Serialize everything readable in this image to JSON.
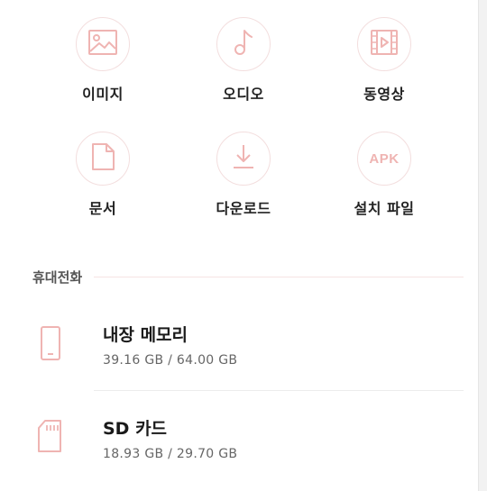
{
  "categories": [
    {
      "label": "이미지",
      "icon": "image-icon"
    },
    {
      "label": "오디오",
      "icon": "music-note-icon"
    },
    {
      "label": "동영상",
      "icon": "video-icon"
    },
    {
      "label": "문서",
      "icon": "document-icon"
    },
    {
      "label": "다운로드",
      "icon": "download-icon"
    },
    {
      "label": "설치 파일",
      "icon": "apk-icon",
      "icon_text": "APK"
    }
  ],
  "phone_section": {
    "title": "휴대전화",
    "items": [
      {
        "name": "내장 메모리",
        "size": "39.16 GB / 64.00 GB",
        "icon": "phone-storage-icon"
      },
      {
        "name": "SD 카드",
        "size": "18.93 GB / 29.70 GB",
        "icon": "sd-card-icon"
      }
    ]
  },
  "colors": {
    "accent": "#efb4b2",
    "circle_border": "#f3dede"
  }
}
